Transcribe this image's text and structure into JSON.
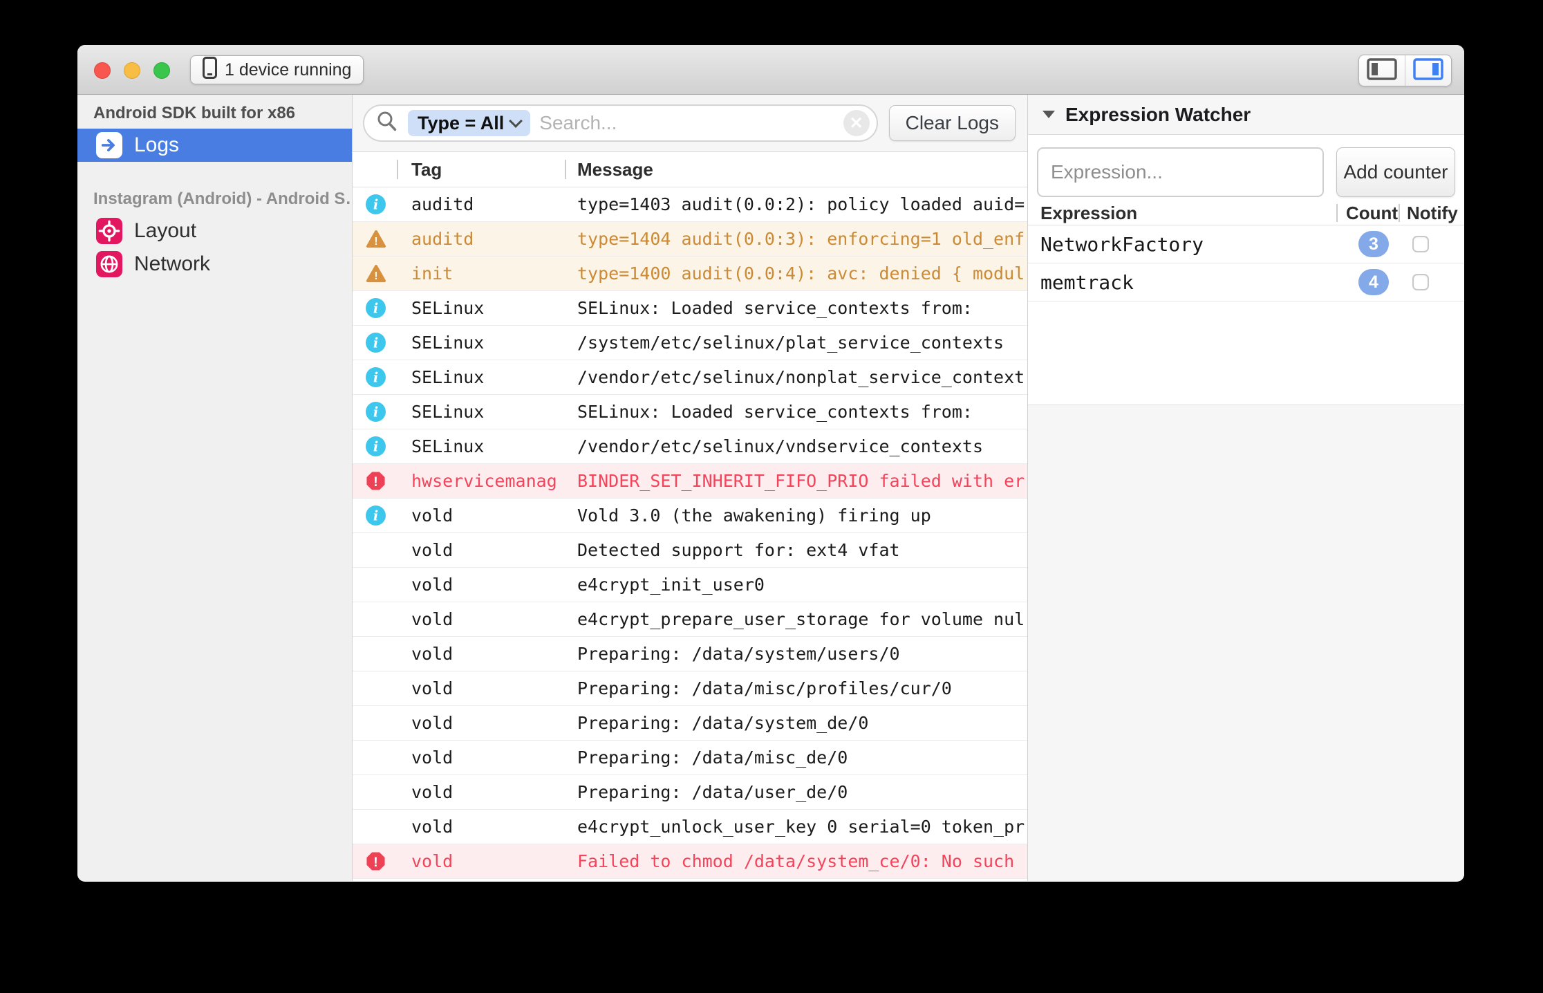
{
  "colors": {
    "accent_blue": "#4a7de1",
    "flipper_pink": "#e2175f",
    "info_icon": "#3ec7ec",
    "warning_text": "#cb8a35",
    "warning_icon": "#d8923f",
    "warning_bg": "#fcf4e6",
    "error_text": "#f4445b",
    "error_icon": "#ee4156",
    "error_bg": "#fdedee",
    "count_badge_bg": "#84a9e8"
  },
  "titlebar": {
    "device_button_label": "1 device running"
  },
  "sidebar": {
    "sections": [
      {
        "label": "Android SDK built for x86",
        "items": [
          {
            "label": "Logs",
            "icon": "arrow-right-icon",
            "selected": true
          }
        ]
      },
      {
        "label": "Instagram (Android) - Android S…",
        "items": [
          {
            "label": "Layout",
            "icon": "target-icon",
            "selected": false
          },
          {
            "label": "Network",
            "icon": "globe-icon",
            "selected": false
          }
        ]
      }
    ]
  },
  "toolbar": {
    "filter_pill_label": "Type = All",
    "search_placeholder": "Search...",
    "clear_logs_label": "Clear Logs"
  },
  "log_table": {
    "columns": [
      "Tag",
      "Message"
    ],
    "rows": [
      {
        "level": "info",
        "tag": "auditd",
        "message": "type=1403 audit(0.0:2): policy loaded auid="
      },
      {
        "level": "warn",
        "tag": "auditd",
        "message": "type=1404 audit(0.0:3): enforcing=1 old_enf"
      },
      {
        "level": "warn",
        "tag": "init",
        "message": "type=1400 audit(0.0:4): avc: denied { modul"
      },
      {
        "level": "info",
        "tag": "SELinux",
        "message": "SELinux: Loaded service_contexts from:"
      },
      {
        "level": "info",
        "tag": "SELinux",
        "message": "/system/etc/selinux/plat_service_contexts"
      },
      {
        "level": "info",
        "tag": "SELinux",
        "message": "/vendor/etc/selinux/nonplat_service_context"
      },
      {
        "level": "info",
        "tag": "SELinux",
        "message": "SELinux: Loaded service_contexts from:"
      },
      {
        "level": "info",
        "tag": "SELinux",
        "message": "/vendor/etc/selinux/vndservice_contexts"
      },
      {
        "level": "error",
        "tag": "hwservicemanag",
        "message": "BINDER_SET_INHERIT_FIFO_PRIO failed with er"
      },
      {
        "level": "info",
        "tag": "vold",
        "message": "Vold 3.0 (the awakening) firing up"
      },
      {
        "level": "none",
        "tag": "vold",
        "message": "Detected support for: ext4 vfat"
      },
      {
        "level": "none",
        "tag": "vold",
        "message": "e4crypt_init_user0"
      },
      {
        "level": "none",
        "tag": "vold",
        "message": "e4crypt_prepare_user_storage for volume nul"
      },
      {
        "level": "none",
        "tag": "vold",
        "message": "Preparing: /data/system/users/0"
      },
      {
        "level": "none",
        "tag": "vold",
        "message": "Preparing: /data/misc/profiles/cur/0"
      },
      {
        "level": "none",
        "tag": "vold",
        "message": "Preparing: /data/system_de/0"
      },
      {
        "level": "none",
        "tag": "vold",
        "message": "Preparing: /data/misc_de/0"
      },
      {
        "level": "none",
        "tag": "vold",
        "message": "Preparing: /data/user_de/0"
      },
      {
        "level": "none",
        "tag": "vold",
        "message": "e4crypt_unlock_user_key 0 serial=0 token_pr"
      },
      {
        "level": "error",
        "tag": "vold",
        "message": "Failed to chmod /data/system_ce/0: No such"
      }
    ]
  },
  "expression_watcher": {
    "title": "Expression Watcher",
    "input_placeholder": "Expression...",
    "add_button_label": "Add counter",
    "columns": [
      "Expression",
      "Count",
      "Notify"
    ],
    "rows": [
      {
        "expression": "NetworkFactory",
        "count": 3,
        "notify": false
      },
      {
        "expression": "memtrack",
        "count": 4,
        "notify": false
      }
    ]
  }
}
